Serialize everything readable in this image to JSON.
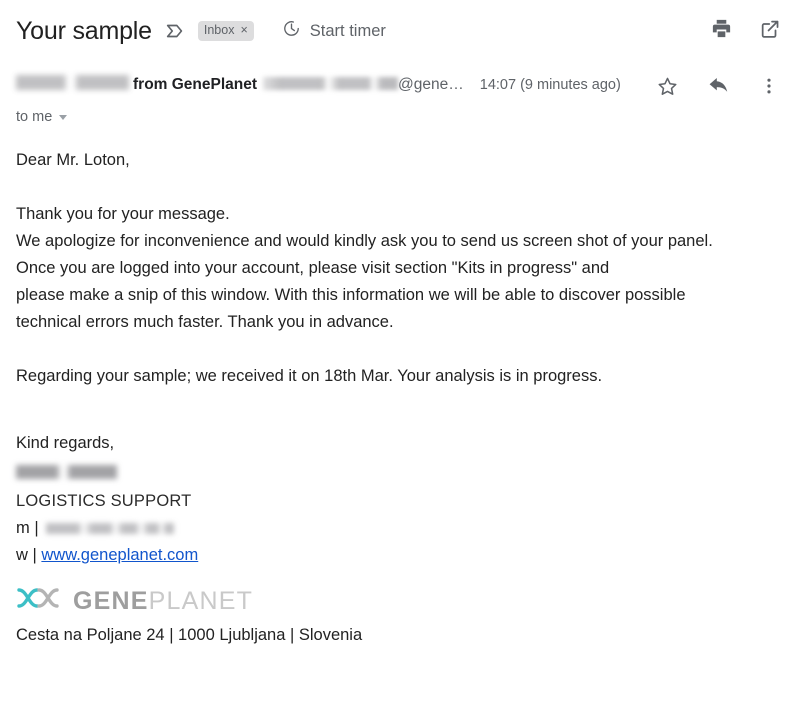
{
  "header": {
    "subject": "Your sample",
    "label_icon": "label-outline-icon",
    "inbox_chip": {
      "label": "Inbox",
      "remove": "×"
    },
    "timer": {
      "icon": "timer-clock-icon",
      "label": "Start timer"
    },
    "actions": [
      {
        "name": "print-icon",
        "title": "Print all"
      },
      {
        "name": "open-in-new-window-icon",
        "title": "Open in new window"
      }
    ]
  },
  "message": {
    "sender_name_redacted": true,
    "from_org": "from GenePlanet",
    "email_redacted": true,
    "email_visible": "@gene…",
    "timestamp": "14:07 (9 minutes ago)",
    "recipient": "to me",
    "actions": [
      {
        "name": "star-icon",
        "title": "Star"
      },
      {
        "name": "reply-icon",
        "title": "Reply"
      },
      {
        "name": "more-options-icon",
        "title": "More"
      }
    ]
  },
  "body": {
    "greeting": "Dear Mr. Loton,",
    "lines": [
      "Thank you for your message.",
      "We apologize for inconvenience and would kindly ask you to send us screen shot of your panel.",
      "Once you are logged into your account, please visit section \"Kits in progress\" and",
      "please make a snip of this window. With this information we will be able to discover possible",
      "technical errors much faster. Thank you in advance."
    ],
    "closing_paragraph": "Regarding your sample; we received it on 18th Mar. Your analysis is in progress.",
    "sign_off": "Kind regards,"
  },
  "signature": {
    "name_redacted": true,
    "role": "LOGISTICS SUPPORT",
    "mobile_prefix": "m |",
    "mobile_redacted": true,
    "web_prefix": "w |",
    "website": "www.geneplanet.com",
    "logo": {
      "mark": "geneplanet-dna-mark",
      "text_primary": "GENE",
      "text_secondary": "PLANET",
      "mark_color_teal": "#3cbfc6",
      "mark_color_gray": "#b4b4b4"
    },
    "address": "Cesta na Poljane 24 | 1000 Ljubljana | Slovenia"
  }
}
